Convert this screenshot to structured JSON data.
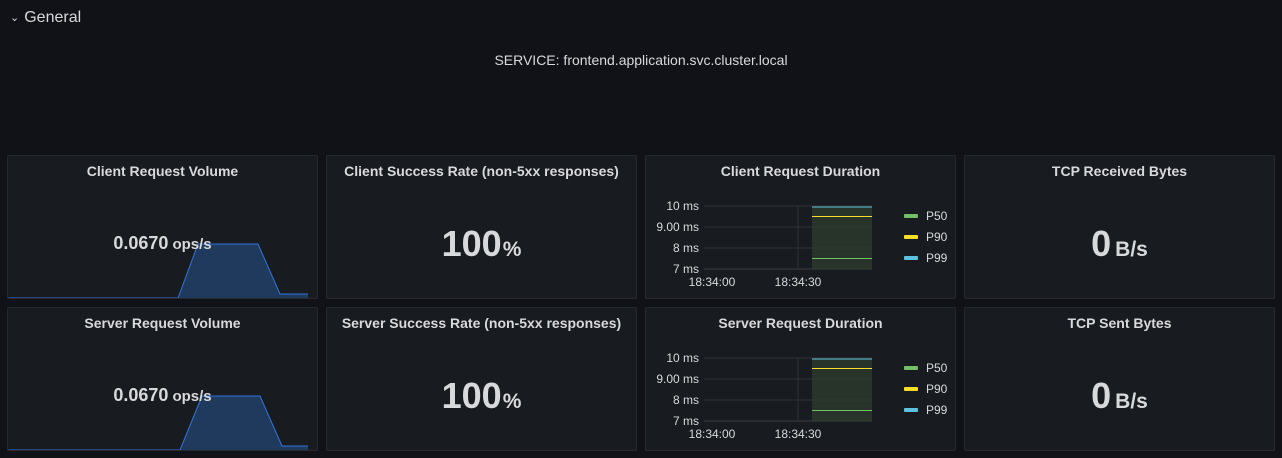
{
  "row": {
    "title": "General"
  },
  "service_text": "SERVICE: frontend.application.svc.cluster.local",
  "panels": {
    "client_request_volume": {
      "title": "Client Request Volume",
      "value": "0.0670",
      "unit": "ops/s"
    },
    "client_success_rate": {
      "title": "Client Success Rate (non-5xx responses)",
      "value": "100",
      "unit": "%"
    },
    "client_request_duration": {
      "title": "Client Request Duration",
      "y_ticks": [
        "10 ms",
        "9.00 ms",
        "8 ms",
        "7 ms"
      ],
      "x_ticks": [
        "18:34:00",
        "18:34:30"
      ],
      "legend": [
        "P50",
        "P90",
        "P99"
      ]
    },
    "tcp_received_bytes": {
      "title": "TCP Received Bytes",
      "value": "0",
      "unit": "B/s"
    },
    "server_request_volume": {
      "title": "Server Request Volume",
      "value": "0.0670",
      "unit": "ops/s"
    },
    "server_success_rate": {
      "title": "Server Success Rate (non-5xx responses)",
      "value": "100",
      "unit": "%"
    },
    "server_request_duration": {
      "title": "Server Request Duration",
      "y_ticks": [
        "10 ms",
        "9.00 ms",
        "8 ms",
        "7 ms"
      ],
      "x_ticks": [
        "18:34:00",
        "18:34:30"
      ],
      "legend": [
        "P50",
        "P90",
        "P99"
      ]
    },
    "tcp_sent_bytes": {
      "title": "TCP Sent Bytes",
      "value": "0",
      "unit": "B/s"
    }
  },
  "colors": {
    "p50": "#73bf69",
    "p90": "#fade2a",
    "p99": "#8ab8ff",
    "p99_alt": "#5dc2e0",
    "spark_line": "#3274d9",
    "spark_fill": "#1f3a5c"
  },
  "chart_data": [
    {
      "type": "line",
      "title": "Client Request Duration",
      "x": [
        "18:34:00",
        "18:34:30"
      ],
      "ylim": [
        7,
        10
      ],
      "series": [
        {
          "name": "P50",
          "values": [
            7.5,
            7.5
          ]
        },
        {
          "name": "P90",
          "values": [
            9.5,
            9.5
          ]
        },
        {
          "name": "P99",
          "values": [
            9.95,
            9.95
          ]
        }
      ]
    },
    {
      "type": "line",
      "title": "Server Request Duration",
      "x": [
        "18:34:00",
        "18:34:30"
      ],
      "ylim": [
        7,
        10
      ],
      "series": [
        {
          "name": "P50",
          "values": [
            7.5,
            7.5
          ]
        },
        {
          "name": "P90",
          "values": [
            9.5,
            9.5
          ]
        },
        {
          "name": "P99",
          "values": [
            9.95,
            9.95
          ]
        }
      ]
    }
  ]
}
